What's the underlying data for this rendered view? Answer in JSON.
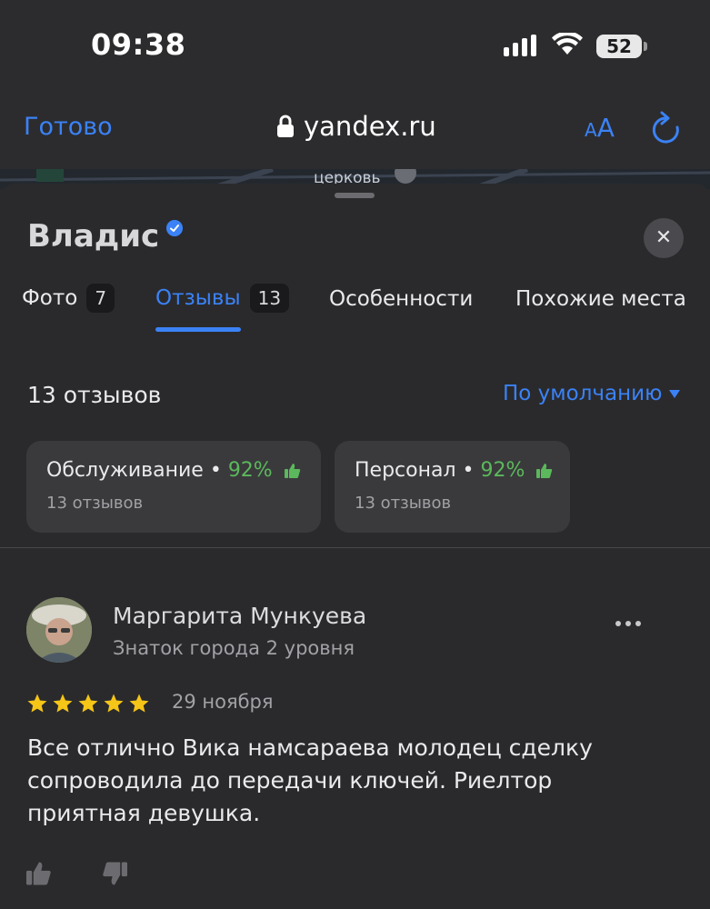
{
  "status_bar": {
    "time": "09:38",
    "battery": "52"
  },
  "browser": {
    "done_label": "Готово",
    "url": "yandex.ru",
    "text_size_label_small": "A",
    "text_size_label_large": "A"
  },
  "map": {
    "label": "церковь"
  },
  "place": {
    "title": "Владис"
  },
  "tabs": [
    {
      "label": "Фото",
      "count": "7"
    },
    {
      "label": "Отзывы",
      "count": "13"
    },
    {
      "label": "Особенности"
    },
    {
      "label": "Похожие места"
    }
  ],
  "reviews": {
    "count_label": "13 отзывов",
    "sort_label": "По умолчанию",
    "aspects": [
      {
        "name": "Обслуживание",
        "percent": "92%",
        "count": "13 отзывов"
      },
      {
        "name": "Персонал",
        "percent": "92%",
        "count": "13 отзывов"
      }
    ],
    "items": [
      {
        "author": "Маргарита Мункуева",
        "level": "Знаток города 2 уровня",
        "rating": 5,
        "date": "29 ноября",
        "text": "Все отлично Вика намсараева молодец сделку сопроводила до передачи ключей. Риелтор приятная девушка."
      }
    ]
  },
  "colors": {
    "accent": "#3b82f6",
    "positive": "#5cb85c",
    "star": "#f5c518",
    "background": "#2a2a2c"
  }
}
